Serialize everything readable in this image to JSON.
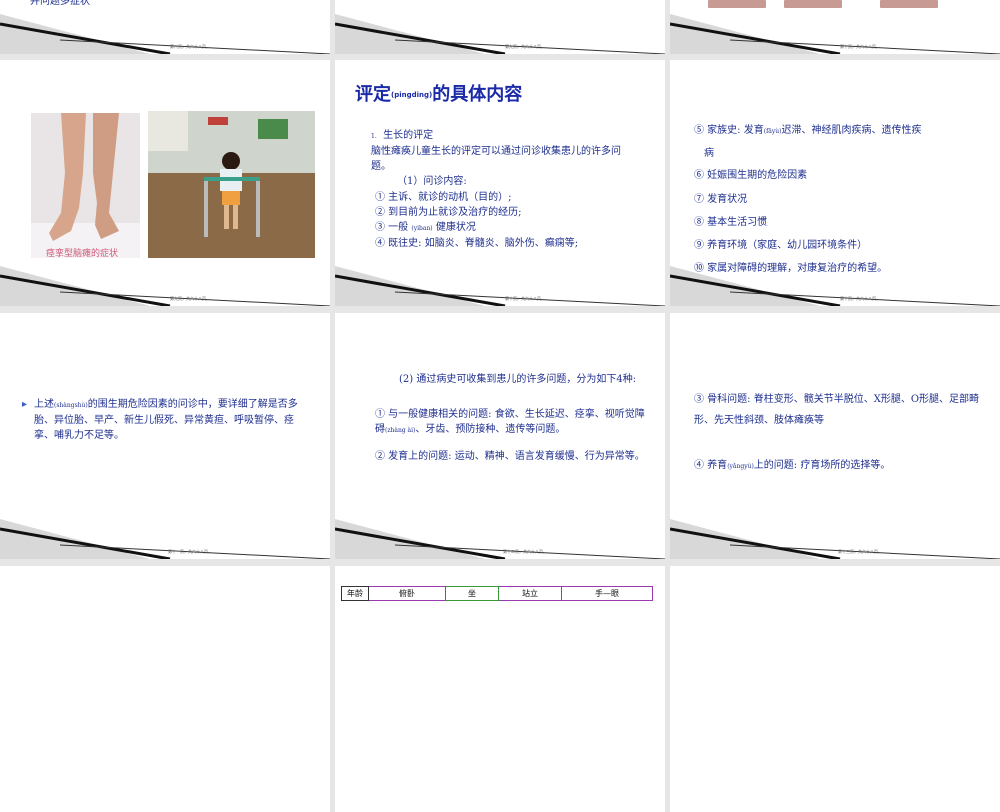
{
  "slides": {
    "top_left": {
      "partial_text": "并问题多症状",
      "page_label": "第八页，共六十八页。"
    },
    "top_mid": {
      "page_label": "第九页，共六十八页。"
    },
    "top_right": {
      "page_label": "第十页，共六十八页。"
    },
    "s4": {
      "caption": "痉挛型脑瘫的症状",
      "page_label": "第九页，共六十八页。"
    },
    "s5": {
      "title_main": "评定",
      "title_pinyin": "(pingding)",
      "title_rest": "的具体内容",
      "heading_num": "1.",
      "heading": "生长的评定",
      "intro": "脑性瘫痪儿童生长的评定可以通过问诊收集患儿的许多问题。",
      "sub": "（1）问诊内容:",
      "items": [
        "① 主诉、就诊的动机（目的）;",
        "② 到目前为止就诊及治疗的经历;",
        "③ 一般",
        "④ 既往史: 如脑炎、脊髓炎、脑外伤、癫痫等;"
      ],
      "item3_pinyin": "(yiban)",
      "item3_rest": "健康状况",
      "page_label": "第十页，共六十八页。"
    },
    "s6": {
      "item5_a": "⑤ 家族史: 发育",
      "item5_pinyin": "(fāyù)",
      "item5_b": "迟滞、神经肌肉疾病、遗传性疾",
      "item5_c": "病",
      "items": [
        "⑥ 妊娠围生期的危险因素",
        "⑦ 发育状况",
        "⑧ 基本生活习惯",
        "⑨ 养育环境（家庭、幼儿园环境条件）",
        "⑩ 家属对障碍的理解，对康复治疗的希望。"
      ],
      "page_label": "第十页，共六十八页。"
    },
    "s7": {
      "bullet": "▸",
      "text_a": "上述",
      "pinyin": "(shàngshù)",
      "text_b": "的围生期危险因素的问诊中，要详细了解是否多胎、异位胎、早产、新生儿假死、异常黄疸、呼吸暂停、痉挛、哺乳力不足等。",
      "page_label": "第十一页，共六十八页。"
    },
    "s8": {
      "p1": "(2) 通过病史可收集到患儿的许多问题，分为如下4种:",
      "p2_a": "① 与一般健康相关的问题: 食欲、生长延迟、痉挛、视听觉障碍",
      "p2_pinyin": "(zhàng ài)",
      "p2_b": "、牙齿、预防接种、遗传等问题。",
      "p3": "② 发育上的问题: 运动、精神、语言发育缓慢、行为异常等。",
      "page_label": "第十二页，共六十八页。"
    },
    "s9": {
      "p1": "③ 骨科问题: 脊柱变形、髋关节半脱位、X形腿、O形腿、足部畸形、先天性斜颈、肢体瘫痪等",
      "p2_a": "④ 养育",
      "p2_pinyin": "(yǎngyù)",
      "p2_b": "上的问题: 疗育场所的选择等。",
      "page_label": "第十三页，共六十八页。"
    },
    "s11": {
      "headers": [
        "年龄",
        "俯卧",
        "坐",
        "站立",
        "手—眼"
      ]
    }
  },
  "colors": {
    "text_blue": "#1f2f8f",
    "title_blue": "#1a2aa8",
    "caption_pink": "#d05a7a"
  }
}
